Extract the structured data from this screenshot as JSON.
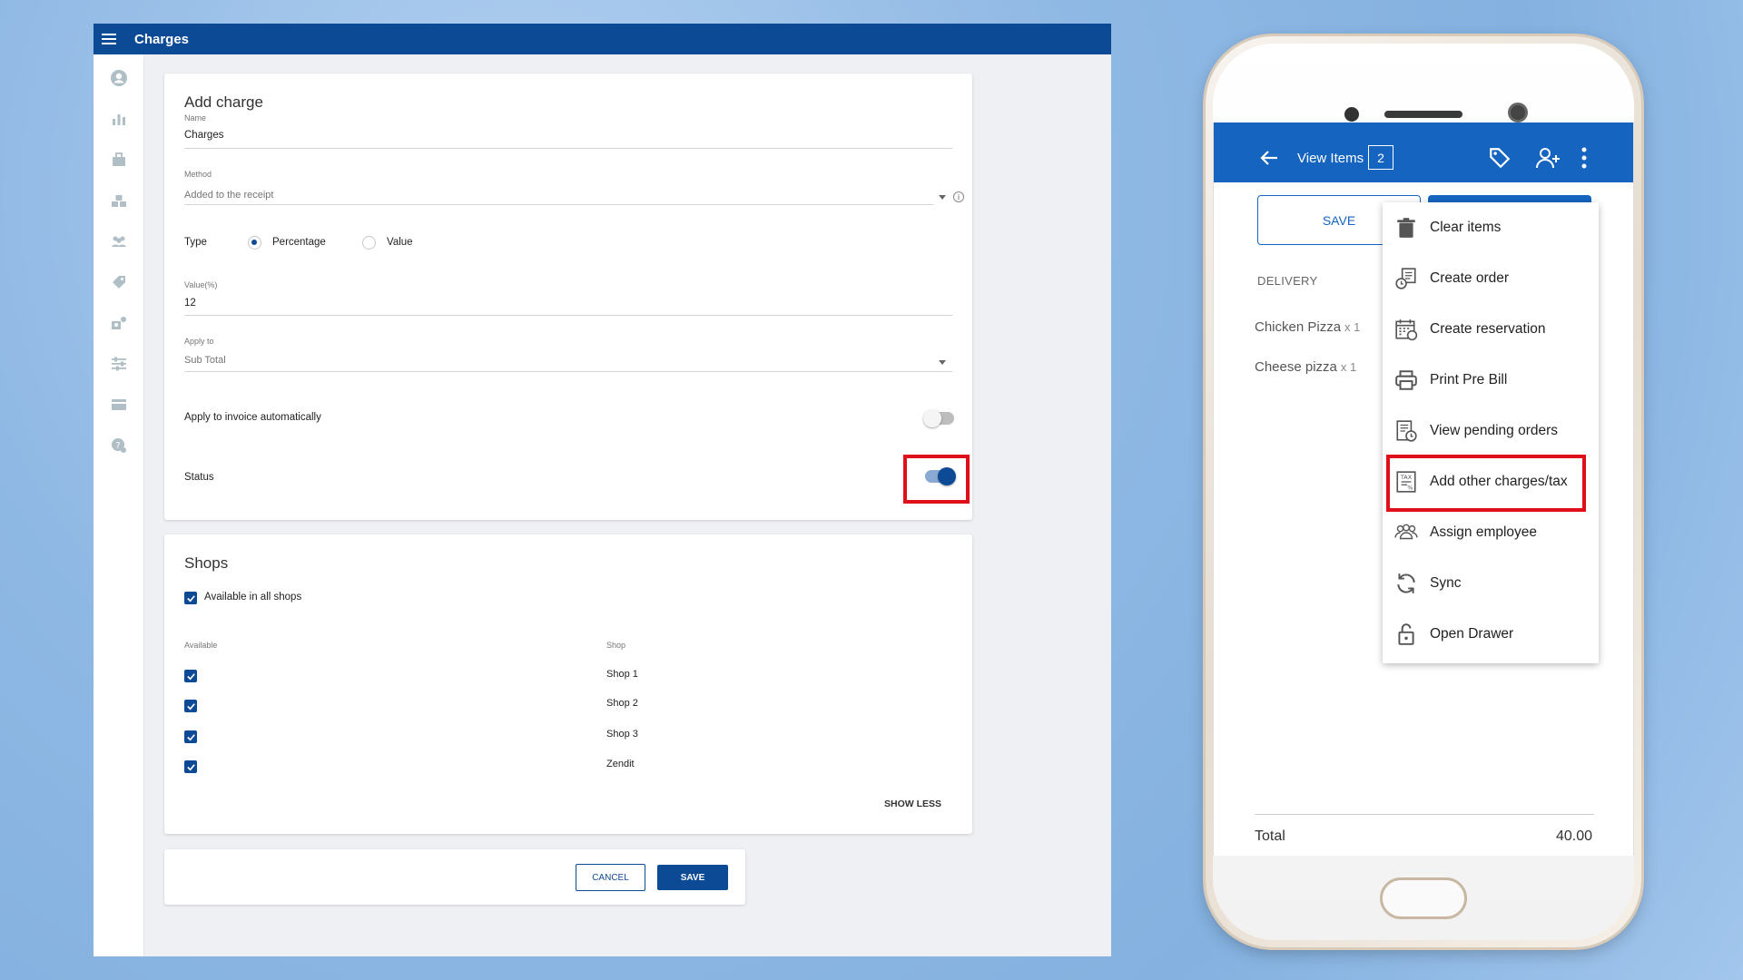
{
  "web": {
    "title": "Charges",
    "add_charge": {
      "heading": "Add charge",
      "name_label": "Name",
      "name_value": "Charges",
      "method_label": "Method",
      "method_value": "Added to the receipt",
      "type_label": "Type",
      "type_option_percentage": "Percentage",
      "type_option_value": "Value",
      "type_selected": "Percentage",
      "value_label": "Value(%)",
      "value_value": "12",
      "apply_to_label": "Apply to",
      "apply_to_value": "Sub Total",
      "auto_label": "Apply to invoice automatically",
      "auto_enabled": false,
      "status_label": "Status",
      "status_enabled": true
    },
    "shops": {
      "heading": "Shops",
      "all_shops_label": "Available in all shops",
      "col_available": "Available",
      "col_shop": "Shop",
      "rows": [
        {
          "available": true,
          "shop": "Shop 1"
        },
        {
          "available": true,
          "shop": "Shop 2"
        },
        {
          "available": true,
          "shop": "Shop 3"
        },
        {
          "available": true,
          "shop": "Zendit"
        }
      ],
      "show_less": "SHOW LESS"
    },
    "actions": {
      "cancel": "CANCEL",
      "save": "SAVE"
    },
    "sidebar_icons": [
      "account-icon",
      "reports-icon",
      "items-icon",
      "inventory-icon",
      "employees-icon",
      "discounts-icon",
      "customers-icon",
      "settings-icon",
      "billing-icon",
      "help-icon"
    ]
  },
  "phone": {
    "appbar_title": "View Items",
    "item_count": "2",
    "save_label": "SAVE",
    "order_type": "DELIVERY",
    "items": [
      {
        "name": "Chicken Pizza",
        "qty": "x 1"
      },
      {
        "name": "Cheese pizza",
        "qty": "x 1"
      }
    ],
    "total_label": "Total",
    "total_value": "40.00",
    "menu": [
      {
        "label": "Clear items",
        "icon": "trash-icon"
      },
      {
        "label": "Create order",
        "icon": "create-order-icon"
      },
      {
        "label": "Create reservation",
        "icon": "calendar-icon"
      },
      {
        "label": "Print Pre Bill",
        "icon": "printer-icon"
      },
      {
        "label": "View pending orders",
        "icon": "pending-orders-icon"
      },
      {
        "label": "Add other charges/tax",
        "icon": "tax-icon"
      },
      {
        "label": "Assign employee",
        "icon": "employees-icon"
      },
      {
        "label": "Sync",
        "icon": "sync-icon"
      },
      {
        "label": "Open Drawer",
        "icon": "unlock-icon"
      }
    ]
  },
  "colors": {
    "primary_web": "#0d4a96",
    "primary_app": "#1565c0",
    "highlight": "#e0101a"
  }
}
